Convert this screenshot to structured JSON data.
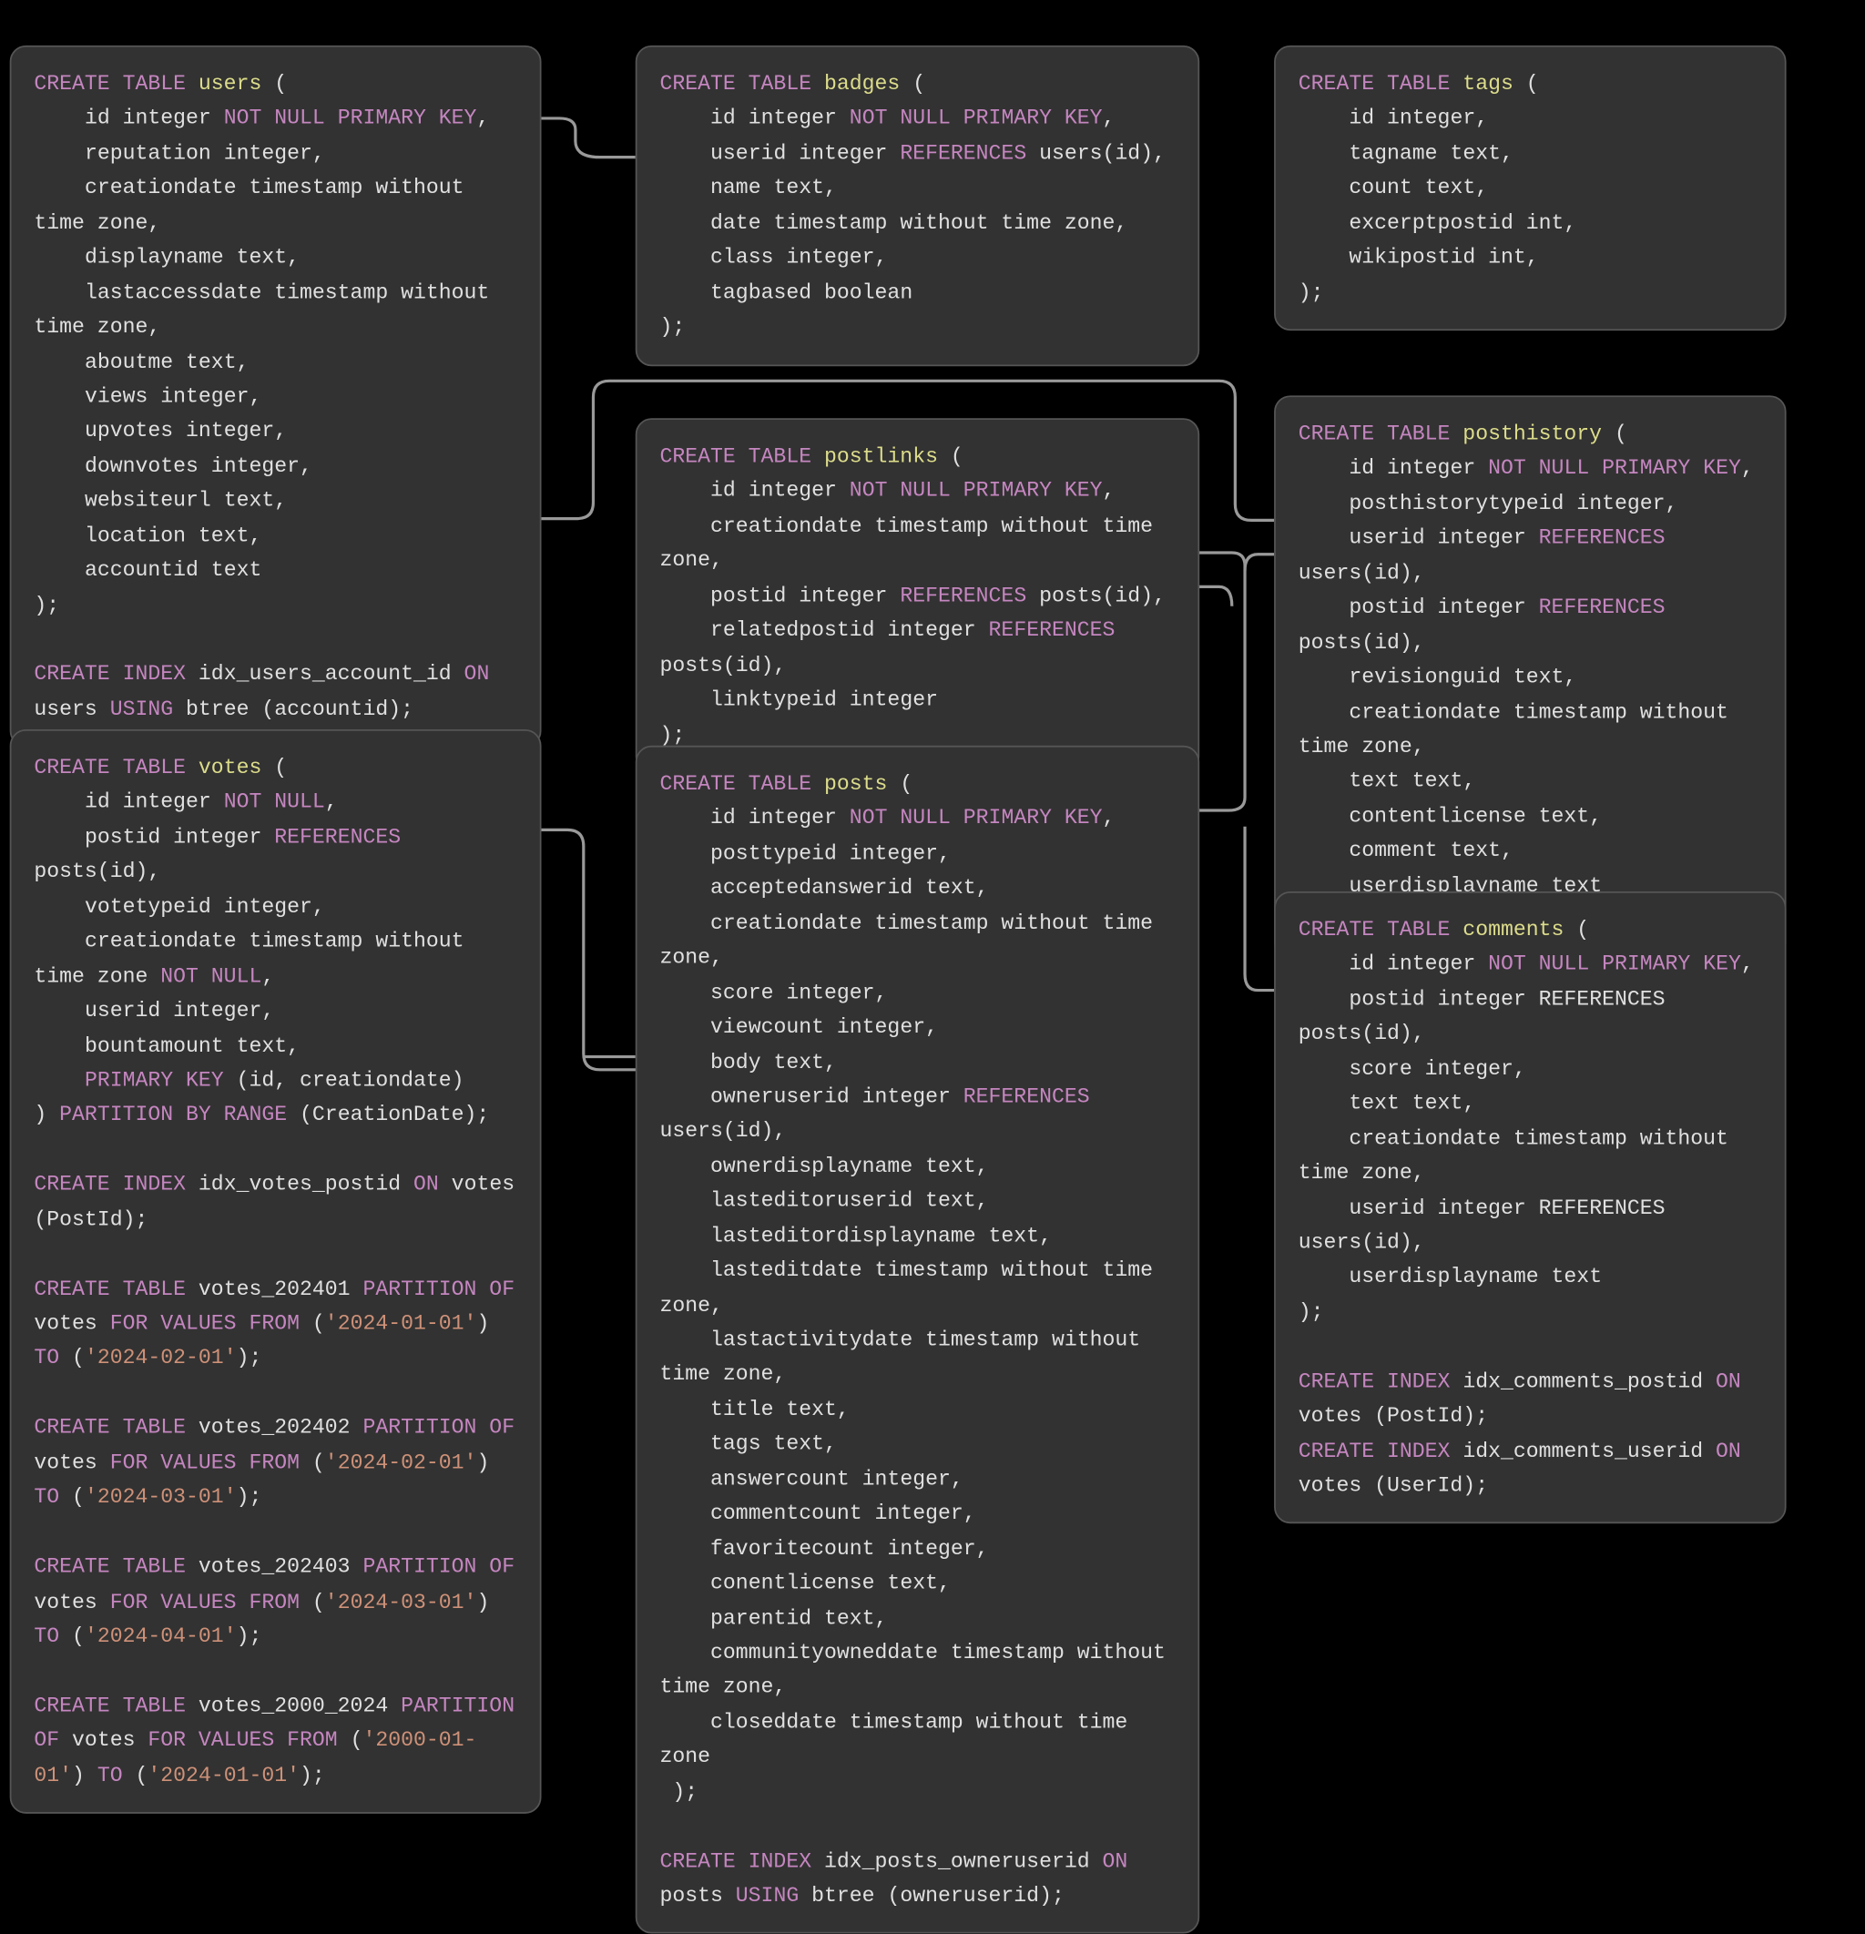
{
  "diagram": {
    "type": "entity-relationship",
    "entities": [
      "users",
      "badges",
      "tags",
      "votes",
      "postlinks",
      "posthistory",
      "posts",
      "comments"
    ],
    "relationships": [
      {
        "from": "badges.userid",
        "to": "users.id"
      },
      {
        "from": "votes.postid",
        "to": "posts.id"
      },
      {
        "from": "postlinks.postid",
        "to": "posts.id"
      },
      {
        "from": "postlinks.relatedpostid",
        "to": "posts.id"
      },
      {
        "from": "posthistory.userid",
        "to": "users.id"
      },
      {
        "from": "posthistory.postid",
        "to": "posts.id"
      },
      {
        "from": "posts.owneruserid",
        "to": "users.id"
      },
      {
        "from": "comments.postid",
        "to": "posts.id"
      }
    ]
  },
  "boxes": {
    "users": {
      "leader": "CREATE TABLE ",
      "name": "users",
      "open": " (",
      "lines": [
        {
          "pre": "    id integer ",
          "kw": "NOT NULL PRIMARY KEY",
          "post": ","
        },
        {
          "pre": "    reputation integer,"
        },
        {
          "pre": "    creationdate timestamp without time zone,"
        },
        {
          "pre": "    displayname text,"
        },
        {
          "pre": "    lastaccessdate timestamp without time zone,"
        },
        {
          "pre": "    aboutme text,"
        },
        {
          "pre": "    views integer,"
        },
        {
          "pre": "    upvotes integer,"
        },
        {
          "pre": "    downvotes integer,"
        },
        {
          "pre": "    websiteurl text,"
        },
        {
          "pre": "    location text,"
        },
        {
          "pre": "    accountid text"
        },
        {
          "pre": ");"
        }
      ],
      "tail_tokens": [
        {
          "t": "\nCREATE INDEX",
          "c": "kw"
        },
        {
          "t": " idx_users_account_id ",
          "c": "txt"
        },
        {
          "t": "ON",
          "c": "kw"
        },
        {
          "t": " users ",
          "c": "txt"
        },
        {
          "t": "USING",
          "c": "kw"
        },
        {
          "t": " btree (accountid);",
          "c": "txt"
        }
      ]
    },
    "badges": {
      "leader": "CREATE TABLE ",
      "name": "badges",
      "open": " (",
      "lines": [
        {
          "pre": "    id integer ",
          "kw": "NOT NULL PRIMARY KEY",
          "post": ","
        },
        {
          "pre": "    userid integer ",
          "kw": "REFERENCES",
          "post": " users(id),"
        },
        {
          "pre": "    name text,"
        },
        {
          "pre": "    date timestamp without time zone,"
        },
        {
          "pre": "    class integer,"
        },
        {
          "pre": "    tagbased boolean"
        },
        {
          "pre": ");"
        }
      ]
    },
    "tags": {
      "leader": "CREATE TABLE ",
      "name": "tags",
      "open": " (",
      "lines": [
        {
          "pre": "    id integer,"
        },
        {
          "pre": "    tagname text,"
        },
        {
          "pre": "    count text,"
        },
        {
          "pre": "    excerptpostid int,"
        },
        {
          "pre": "    wikipostid int,"
        },
        {
          "pre": ");"
        }
      ]
    },
    "votes": {
      "leader": "CREATE TABLE ",
      "name": "votes",
      "open": " (",
      "lines": [
        {
          "pre": "    id integer ",
          "kw": "NOT NULL",
          "post": ","
        },
        {
          "pre": "    postid integer ",
          "kw": "REFERENCES",
          "post": " posts(id),"
        },
        {
          "pre": "    votetypeid integer,"
        },
        {
          "pre": "    creationdate timestamp without time zone ",
          "kw": "NOT NULL",
          "no_indent_kw": true,
          "post": ","
        },
        {
          "pre": "    userid integer,"
        },
        {
          "pre": "    bountamount text,"
        },
        {
          "pre": "    ",
          "kw": "PRIMARY KEY",
          "post": " (id, creationdate)"
        },
        {
          "pre": ") ",
          "kw": "PARTITION BY RANGE",
          "post": " (CreationDate);",
          "no_indent": true
        }
      ],
      "tail_tokens": [
        {
          "t": "\nCREATE INDEX",
          "c": "kw"
        },
        {
          "t": " idx_votes_postid ",
          "c": "txt"
        },
        {
          "t": "ON",
          "c": "kw"
        },
        {
          "t": " votes (PostId);\n\n",
          "c": "txt"
        },
        {
          "t": "CREATE TABLE",
          "c": "kw"
        },
        {
          "t": " votes_202401 ",
          "c": "txt"
        },
        {
          "t": "PARTITION OF",
          "c": "kw"
        },
        {
          "t": " votes ",
          "c": "txt"
        },
        {
          "t": "FOR VALUES FROM",
          "c": "kw"
        },
        {
          "t": " (",
          "c": "txt"
        },
        {
          "t": "'2024-01-01'",
          "c": "str"
        },
        {
          "t": ") ",
          "c": "txt"
        },
        {
          "t": "TO",
          "c": "kw"
        },
        {
          "t": " (",
          "c": "txt"
        },
        {
          "t": "'2024-02-01'",
          "c": "str"
        },
        {
          "t": ");\n\n",
          "c": "txt"
        },
        {
          "t": "CREATE TABLE",
          "c": "kw"
        },
        {
          "t": " votes_202402 ",
          "c": "txt"
        },
        {
          "t": "PARTITION OF",
          "c": "kw"
        },
        {
          "t": " votes ",
          "c": "txt"
        },
        {
          "t": "FOR VALUES FROM",
          "c": "kw"
        },
        {
          "t": " (",
          "c": "txt"
        },
        {
          "t": "'2024-02-01'",
          "c": "str"
        },
        {
          "t": ") ",
          "c": "txt"
        },
        {
          "t": "TO",
          "c": "kw"
        },
        {
          "t": " (",
          "c": "txt"
        },
        {
          "t": "'2024-03-01'",
          "c": "str"
        },
        {
          "t": ");\n\n",
          "c": "txt"
        },
        {
          "t": "CREATE TABLE",
          "c": "kw"
        },
        {
          "t": " votes_202403 ",
          "c": "txt"
        },
        {
          "t": "PARTITION OF",
          "c": "kw"
        },
        {
          "t": " votes ",
          "c": "txt"
        },
        {
          "t": "FOR VALUES FROM",
          "c": "kw"
        },
        {
          "t": " (",
          "c": "txt"
        },
        {
          "t": "'2024-03-01'",
          "c": "str"
        },
        {
          "t": ") ",
          "c": "txt"
        },
        {
          "t": "TO",
          "c": "kw"
        },
        {
          "t": " (",
          "c": "txt"
        },
        {
          "t": "'2024-04-01'",
          "c": "str"
        },
        {
          "t": ");\n\n",
          "c": "txt"
        },
        {
          "t": "CREATE TABLE",
          "c": "kw"
        },
        {
          "t": " votes_2000_2024 ",
          "c": "txt"
        },
        {
          "t": "PARTITION OF",
          "c": "kw"
        },
        {
          "t": " votes ",
          "c": "txt"
        },
        {
          "t": "FOR VALUES FROM",
          "c": "kw"
        },
        {
          "t": " (",
          "c": "txt"
        },
        {
          "t": "'2000-01-01'",
          "c": "str"
        },
        {
          "t": ") ",
          "c": "txt"
        },
        {
          "t": "TO",
          "c": "kw"
        },
        {
          "t": " (",
          "c": "txt"
        },
        {
          "t": "'2024-01-01'",
          "c": "str"
        },
        {
          "t": ");",
          "c": "txt"
        }
      ]
    },
    "postlinks": {
      "leader": "CREATE TABLE ",
      "name": "postlinks",
      "open": " (",
      "lines": [
        {
          "pre": "    id integer ",
          "kw": "NOT NULL PRIMARY KEY",
          "post": ","
        },
        {
          "pre": "    creationdate timestamp without time zone,"
        },
        {
          "pre": "    postid integer ",
          "kw": "REFERENCES",
          "post": " posts(id),"
        },
        {
          "pre": "    relatedpostid integer ",
          "kw": "REFERENCES",
          "post": " posts(id),"
        },
        {
          "pre": "    linktypeid integer"
        },
        {
          "pre": ");"
        }
      ]
    },
    "posthistory": {
      "leader": "CREATE TABLE ",
      "name": "posthistory",
      "open": " (",
      "lines": [
        {
          "pre": "    id integer ",
          "kw": "NOT NULL PRIMARY KEY",
          "post": ","
        },
        {
          "pre": "    posthistorytypeid integer,"
        },
        {
          "pre": "    userid integer ",
          "kw": "REFERENCES",
          "post": " users(id),"
        },
        {
          "pre": "    postid integer ",
          "kw": "REFERENCES",
          "post": " posts(id),"
        },
        {
          "pre": "    revisionguid text,"
        },
        {
          "pre": "    creationdate timestamp without time zone,"
        },
        {
          "pre": "    text text,"
        },
        {
          "pre": "    contentlicense text,"
        },
        {
          "pre": "    comment text,"
        },
        {
          "pre": "    userdisplayname text"
        },
        {
          "pre": ");"
        }
      ]
    },
    "posts": {
      "leader": "CREATE TABLE ",
      "name": "posts",
      "open": " (",
      "lines": [
        {
          "pre": "    id integer ",
          "kw": "NOT NULL PRIMARY KEY",
          "post": ","
        },
        {
          "pre": "    posttypeid integer,"
        },
        {
          "pre": "    acceptedanswerid text,"
        },
        {
          "pre": "    creationdate timestamp without time zone,"
        },
        {
          "pre": "    score integer,"
        },
        {
          "pre": "    viewcount integer,"
        },
        {
          "pre": "    body text,"
        },
        {
          "pre": "    owneruserid integer ",
          "kw": "REFERENCES",
          "post": " users(id),"
        },
        {
          "pre": "    ownerdisplayname text,"
        },
        {
          "pre": "    lasteditoruserid text,"
        },
        {
          "pre": "    lasteditordisplayname text,"
        },
        {
          "pre": "    lasteditdate timestamp without time zone,"
        },
        {
          "pre": "    lastactivitydate timestamp without time zone,"
        },
        {
          "pre": "    title text,"
        },
        {
          "pre": "    tags text,"
        },
        {
          "pre": "    answercount integer,"
        },
        {
          "pre": "    commentcount integer,"
        },
        {
          "pre": "    favoritecount integer,"
        },
        {
          "pre": "    conentlicense text,"
        },
        {
          "pre": "    parentid text,"
        },
        {
          "pre": "    communityowneddate timestamp without time zone,"
        },
        {
          "pre": "    closeddate timestamp without time zone "
        },
        {
          "pre": " );"
        }
      ],
      "tail_tokens": [
        {
          "t": "\nCREATE INDEX",
          "c": "kw"
        },
        {
          "t": " idx_posts_owneruserid ",
          "c": "txt"
        },
        {
          "t": "ON",
          "c": "kw"
        },
        {
          "t": " posts ",
          "c": "txt"
        },
        {
          "t": "USING",
          "c": "kw"
        },
        {
          "t": " btree (owneruserid);",
          "c": "txt"
        }
      ]
    },
    "comments": {
      "leader": "CREATE TABLE ",
      "name": "comments",
      "open": " (",
      "lines": [
        {
          "pre": "    id integer ",
          "kw": "NOT NULL PRIMARY KEY",
          "post": ","
        },
        {
          "pre": "    postid integer REFERENCES posts(id),"
        },
        {
          "pre": "    score integer,"
        },
        {
          "pre": "    text text,"
        },
        {
          "pre": "    creationdate timestamp without time zone,"
        },
        {
          "pre": "    userid integer REFERENCES users(id),"
        },
        {
          "pre": "    userdisplayname text"
        },
        {
          "pre": ");"
        }
      ],
      "tail_tokens": [
        {
          "t": "\nCREATE INDEX",
          "c": "kw"
        },
        {
          "t": " idx_comments_postid ",
          "c": "txt"
        },
        {
          "t": "ON",
          "c": "kw"
        },
        {
          "t": " votes (PostId);\n",
          "c": "txt"
        },
        {
          "t": "CREATE INDEX",
          "c": "kw"
        },
        {
          "t": " idx_comments_userid ",
          "c": "txt"
        },
        {
          "t": "ON",
          "c": "kw"
        },
        {
          "t": " votes (UserId);",
          "c": "txt"
        }
      ]
    }
  }
}
